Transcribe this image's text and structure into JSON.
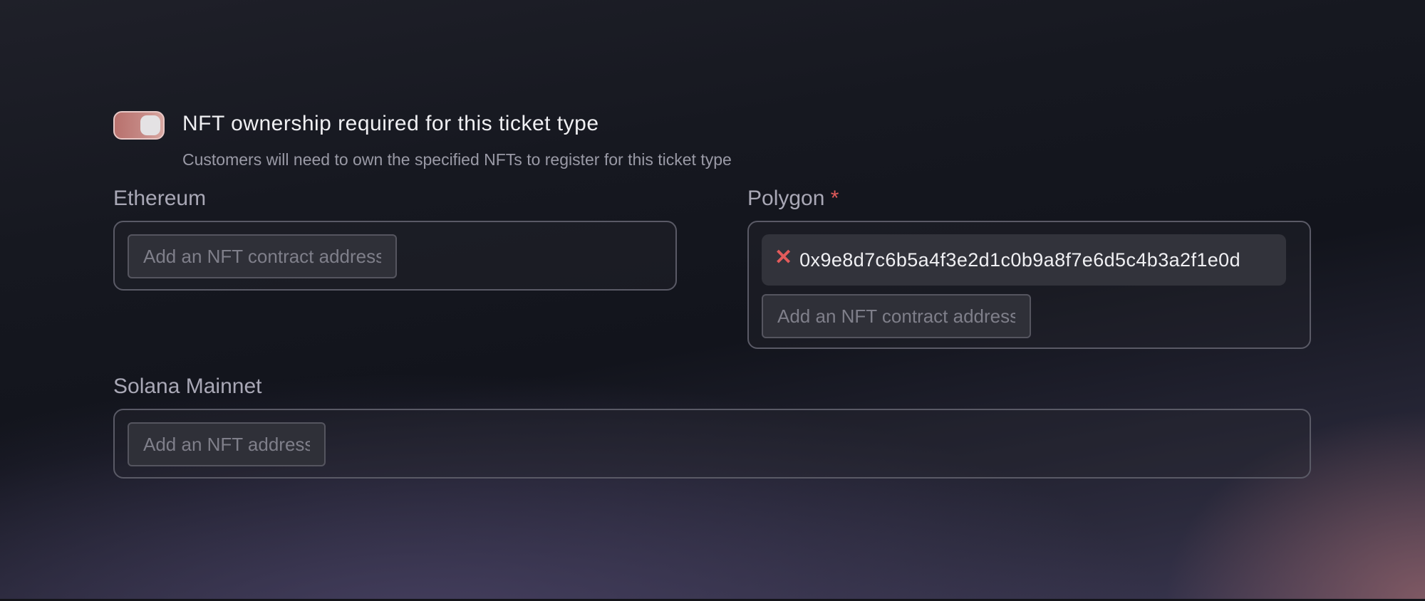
{
  "nft_gate": {
    "toggle_on": true,
    "title": "NFT ownership required for this ticket type",
    "description": "Customers will need to own the specified NFTs to register for this ticket type"
  },
  "fields": {
    "ethereum": {
      "label": "Ethereum",
      "required": false,
      "addresses": [],
      "placeholder": "Add an NFT contract address"
    },
    "polygon": {
      "label": "Polygon",
      "required": true,
      "required_marker": "*",
      "remove_glyph": "✕",
      "addresses": [
        "0x9e8d7c6b5a4f3e2d1c0b9a8f7e6d5c4b3a2f1e0d"
      ],
      "placeholder": "Add an NFT contract address"
    },
    "solana": {
      "label": "Solana Mainnet",
      "required": false,
      "addresses": [],
      "placeholder": "Add an NFT address"
    }
  },
  "colors": {
    "toggle_accent": "#c68a86",
    "required": "#e05a5a",
    "remove_icon": "#e35b5b"
  }
}
